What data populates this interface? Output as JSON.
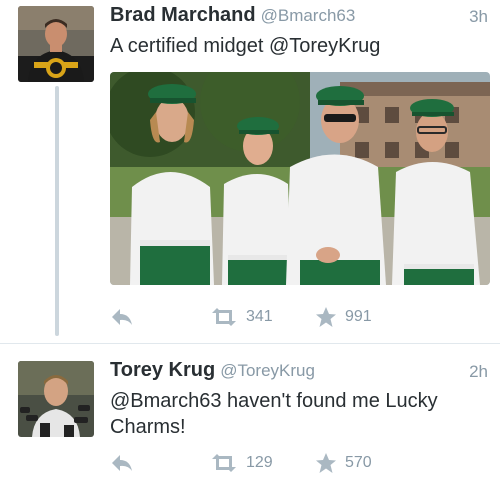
{
  "tweets": [
    {
      "display_name": "Brad Marchand",
      "handle": "@Bmarch63",
      "time": "3h",
      "text": "A certified midget @ToreyKrug",
      "retweet_count": "341",
      "favorite_count": "991",
      "avatar_icon": "hockey-player-avatar",
      "has_media": true
    },
    {
      "display_name": "Torey Krug",
      "handle": "@ToreyKrug",
      "time": "2h",
      "text": "@Bmarch63 haven't found me Lucky Charms!",
      "retweet_count": "129",
      "favorite_count": "570",
      "avatar_icon": "player-interview-avatar",
      "has_media": false
    }
  ],
  "icons": {
    "reply": "reply-icon",
    "retweet": "retweet-icon",
    "favorite": "star-icon"
  },
  "colors": {
    "text": "#292f33",
    "muted": "#8899a6",
    "action_icon": "#aab8c2",
    "thread_line": "#ccd6dd"
  }
}
